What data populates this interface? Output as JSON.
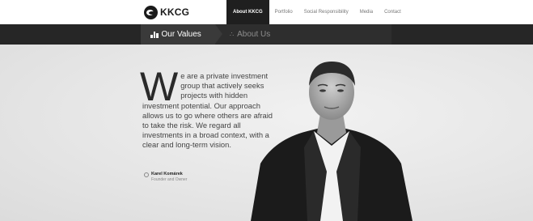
{
  "header": {
    "logo_text": "KKCG",
    "nav": [
      {
        "label": "About KKCG",
        "active": true
      },
      {
        "label": "Portfolio",
        "active": false
      },
      {
        "label": "Social Responsibility",
        "active": false
      },
      {
        "label": "Media",
        "active": false
      },
      {
        "label": "Contact",
        "active": false
      }
    ]
  },
  "subnav": {
    "active_label": "Our Values",
    "inactive_label": "About Us"
  },
  "main": {
    "dropcap": "W",
    "quote": "e are a private investment group that actively seeks projects with hidden investment potential. Our approach allows us to go where others are afraid to take the risk. We regard all investments in a broad context, with a clear and long-term vision.",
    "signature_name": "Karel Komárek",
    "signature_role": "Founder and Owner"
  },
  "icons": {
    "logo": "kkcg-logo-mark",
    "values": "bar-chart-icon",
    "about": "triangle-dots-icon"
  },
  "colors": {
    "dark_bar": "#262626",
    "active_nav": "#1f1f1f",
    "background": "#e9e9e9"
  }
}
